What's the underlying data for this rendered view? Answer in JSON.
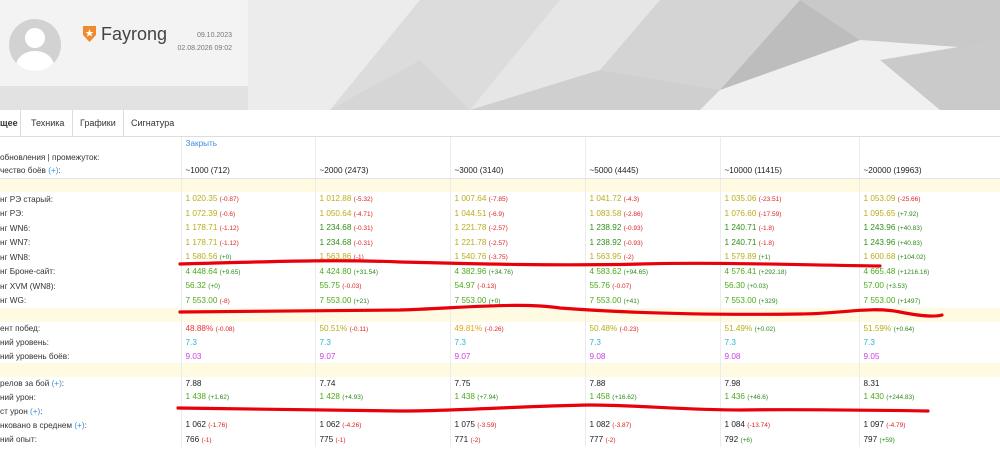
{
  "profile": {
    "name": "Fayrong",
    "date_top": "09.10.2023",
    "date_bottom": "02.08.2026 09:02"
  },
  "tabs": [
    "щее",
    "Техника",
    "Графики",
    "Сигнатура"
  ],
  "table": {
    "close_link": "Закрыть",
    "rows": [
      {
        "type": "header",
        "label": "обновления | промежуток:"
      },
      {
        "type": "head",
        "label": "чество боёв",
        "plus": true,
        "cells": [
          {
            "text": "~1000 (712)"
          },
          {
            "text": "~2000 (2473)"
          },
          {
            "text": "~3000 (3140)"
          },
          {
            "text": "~5000 (4445)"
          },
          {
            "text": "~10000 (11415)"
          },
          {
            "text": "~20000 (19963)"
          }
        ]
      },
      {
        "type": "divider"
      },
      {
        "label": "нг РЭ старый:",
        "cells": [
          {
            "v": "1 020.35",
            "vc": "y",
            "d": "(-0.87)",
            "dc": "dn"
          },
          {
            "v": "1 012.88",
            "vc": "y",
            "d": "(-5.32)",
            "dc": "dn"
          },
          {
            "v": "1 007.64",
            "vc": "y",
            "d": "(-7.85)",
            "dc": "dn"
          },
          {
            "v": "1 041.72",
            "vc": "y",
            "d": "(-4.3)",
            "dc": "dn"
          },
          {
            "v": "1 035.06",
            "vc": "y",
            "d": "(-23.51)",
            "dc": "dn"
          },
          {
            "v": "1 053.09",
            "vc": "y",
            "d": "(-25.66)",
            "dc": "dn"
          }
        ]
      },
      {
        "label": "нг РЭ:",
        "cells": [
          {
            "v": "1 072.39",
            "vc": "y",
            "d": "(-0.6)",
            "dc": "dn"
          },
          {
            "v": "1 050.64",
            "vc": "y",
            "d": "(-4.71)",
            "dc": "dn"
          },
          {
            "v": "1 044.51",
            "vc": "y",
            "d": "(-6.9)",
            "dc": "dn"
          },
          {
            "v": "1 083.58",
            "vc": "y",
            "d": "(-2.86)",
            "dc": "dn"
          },
          {
            "v": "1 076.60",
            "vc": "y",
            "d": "(-17.59)",
            "dc": "dn"
          },
          {
            "v": "1 095.65",
            "vc": "y",
            "d": "(+7.92)",
            "dc": "dp"
          }
        ]
      },
      {
        "label": "нг WN6:",
        "cells": [
          {
            "v": "1 178.71",
            "vc": "y",
            "d": "(-1.12)",
            "dc": "dn"
          },
          {
            "v": "1 234.68",
            "vc": "dg",
            "d": "(-0.31)",
            "dc": "dn"
          },
          {
            "v": "1 221.78",
            "vc": "y",
            "d": "(-2.57)",
            "dc": "dn"
          },
          {
            "v": "1 238.92",
            "vc": "dg",
            "d": "(-0.93)",
            "dc": "dn"
          },
          {
            "v": "1 240.71",
            "vc": "dg",
            "d": "(-1.8)",
            "dc": "dn"
          },
          {
            "v": "1 243.96",
            "vc": "dg",
            "d": "(+40.83)",
            "dc": "dp"
          }
        ]
      },
      {
        "label": "нг WN7:",
        "cells": [
          {
            "v": "1 178.71",
            "vc": "y",
            "d": "(-1.12)",
            "dc": "dn"
          },
          {
            "v": "1 234.68",
            "vc": "dg",
            "d": "(-0.31)",
            "dc": "dn"
          },
          {
            "v": "1 221.78",
            "vc": "y",
            "d": "(-2.57)",
            "dc": "dn"
          },
          {
            "v": "1 238.92",
            "vc": "dg",
            "d": "(-0.93)",
            "dc": "dn"
          },
          {
            "v": "1 240.71",
            "vc": "dg",
            "d": "(-1.8)",
            "dc": "dn"
          },
          {
            "v": "1 243.96",
            "vc": "dg",
            "d": "(+40.83)",
            "dc": "dp"
          }
        ]
      },
      {
        "label": "нг WN8:",
        "cells": [
          {
            "v": "1 580.56",
            "vc": "y",
            "d": "(+0)",
            "dc": "dp"
          },
          {
            "v": "1 563.86",
            "vc": "y",
            "d": "(-1)",
            "dc": "dn"
          },
          {
            "v": "1 540.76",
            "vc": "y",
            "d": "(-3.75)",
            "dc": "dn"
          },
          {
            "v": "1 563.95",
            "vc": "y",
            "d": "(-2)",
            "dc": "dn"
          },
          {
            "v": "1 579.89",
            "vc": "y",
            "d": "(+1)",
            "dc": "dp"
          },
          {
            "v": "1 600.68",
            "vc": "y",
            "d": "(+104.02)",
            "dc": "dp"
          }
        ]
      },
      {
        "label": "нг Броне-сайт:",
        "cells": [
          {
            "v": "4 448.64",
            "vc": "g",
            "d": "(+9.65)",
            "dc": "dp"
          },
          {
            "v": "4 424.80",
            "vc": "g",
            "d": "(+31.54)",
            "dc": "dp"
          },
          {
            "v": "4 382.96",
            "vc": "g",
            "d": "(+34.76)",
            "dc": "dp"
          },
          {
            "v": "4 583.62",
            "vc": "g",
            "d": "(+94.65)",
            "dc": "dp"
          },
          {
            "v": "4 576.41",
            "vc": "g",
            "d": "(+292.18)",
            "dc": "dp"
          },
          {
            "v": "4 665.48",
            "vc": "g",
            "d": "(+1216.16)",
            "dc": "dp"
          }
        ]
      },
      {
        "label": "нг XVM (WN8):",
        "cells": [
          {
            "v": "56.32",
            "vc": "g",
            "d": "(+0)",
            "dc": "dp"
          },
          {
            "v": "55.75",
            "vc": "g",
            "d": "(-0.03)",
            "dc": "dn"
          },
          {
            "v": "54.97",
            "vc": "g",
            "d": "(-0.13)",
            "dc": "dn"
          },
          {
            "v": "55.76",
            "vc": "g",
            "d": "(-0.07)",
            "dc": "dn"
          },
          {
            "v": "56.30",
            "vc": "g",
            "d": "(+0.03)",
            "dc": "dp"
          },
          {
            "v": "57.00",
            "vc": "g",
            "d": "(+3.53)",
            "dc": "dp"
          }
        ]
      },
      {
        "label": "нг WG:",
        "cells": [
          {
            "v": "7 553.00",
            "vc": "g",
            "d": "(-8)",
            "dc": "dn"
          },
          {
            "v": "7 553.00",
            "vc": "g",
            "d": "(+21)",
            "dc": "dp"
          },
          {
            "v": "7 553.00",
            "vc": "g",
            "d": "(+0)",
            "dc": "dp"
          },
          {
            "v": "7 553.00",
            "vc": "g",
            "d": "(+41)",
            "dc": "dp"
          },
          {
            "v": "7 553.00",
            "vc": "g",
            "d": "(+329)",
            "dc": "dp"
          },
          {
            "v": "7 553.00",
            "vc": "g",
            "d": "(+1497)",
            "dc": "dp"
          }
        ]
      },
      {
        "type": "divider"
      },
      {
        "label": "ент побед:",
        "cells": [
          {
            "v": "48.88%",
            "vc": "r",
            "d": "(-0.08)",
            "dc": "dn"
          },
          {
            "v": "50.51%",
            "vc": "y",
            "d": "(-0.11)",
            "dc": "dn"
          },
          {
            "v": "49.81%",
            "vc": "o",
            "d": "(-0.26)",
            "dc": "dn"
          },
          {
            "v": "50.48%",
            "vc": "y",
            "d": "(-0.23)",
            "dc": "dn"
          },
          {
            "v": "51.49%",
            "vc": "y",
            "d": "(+0.02)",
            "dc": "dp"
          },
          {
            "v": "51.59%",
            "vc": "y",
            "d": "(+0.64)",
            "dc": "dp"
          }
        ]
      },
      {
        "label": "ний уровень:",
        "cells": [
          {
            "v": "7.3",
            "vc": "c"
          },
          {
            "v": "7.3",
            "vc": "c"
          },
          {
            "v": "7.3",
            "vc": "c"
          },
          {
            "v": "7.3",
            "vc": "c"
          },
          {
            "v": "7.3",
            "vc": "c"
          },
          {
            "v": "7.3",
            "vc": "c"
          }
        ]
      },
      {
        "label": "ний уровень боёв:",
        "cells": [
          {
            "v": "9.03",
            "vc": "m"
          },
          {
            "v": "9.07",
            "vc": "m"
          },
          {
            "v": "9.07",
            "vc": "m"
          },
          {
            "v": "9.08",
            "vc": "m"
          },
          {
            "v": "9.08",
            "vc": "m"
          },
          {
            "v": "9.05",
            "vc": "m"
          }
        ]
      },
      {
        "type": "divider"
      },
      {
        "label": "релов за бой",
        "plus": true,
        "cells": [
          {
            "v": "7.88",
            "vc": "k"
          },
          {
            "v": "7.74",
            "vc": "k"
          },
          {
            "v": "7.75",
            "vc": "k"
          },
          {
            "v": "7.88",
            "vc": "k"
          },
          {
            "v": "7.98",
            "vc": "k"
          },
          {
            "v": "8.31",
            "vc": "k"
          }
        ]
      },
      {
        "label": "ний урон:",
        "cells": [
          {
            "v": "1 438",
            "vc": "g",
            "d": "(+1.62)",
            "dc": "dp"
          },
          {
            "v": "1 428",
            "vc": "g",
            "d": "(+4.93)",
            "dc": "dp"
          },
          {
            "v": "1 438",
            "vc": "g",
            "d": "(+7.94)",
            "dc": "dp"
          },
          {
            "v": "1 458",
            "vc": "g",
            "d": "(+16.62)",
            "dc": "dp"
          },
          {
            "v": "1 436",
            "vc": "g",
            "d": "(+46.6)",
            "dc": "dp"
          },
          {
            "v": "1 430",
            "vc": "g",
            "d": "(+244.83)",
            "dc": "dp"
          }
        ]
      },
      {
        "label": "ст урон",
        "plus": true,
        "cells": []
      },
      {
        "label": "нковано в среднем",
        "plus": true,
        "cells": [
          {
            "v": "1 062",
            "vc": "k",
            "d": "(-1.76)",
            "dc": "dn"
          },
          {
            "v": "1 062",
            "vc": "k",
            "d": "(-4.26)",
            "dc": "dn"
          },
          {
            "v": "1 075",
            "vc": "k",
            "d": "(-3.59)",
            "dc": "dn"
          },
          {
            "v": "1 082",
            "vc": "k",
            "d": "(-3.87)",
            "dc": "dn"
          },
          {
            "v": "1 084",
            "vc": "k",
            "d": "(-13.74)",
            "dc": "dn"
          },
          {
            "v": "1 097",
            "vc": "k",
            "d": "(-4.79)",
            "dc": "dn"
          }
        ]
      },
      {
        "label": "ний опыт:",
        "cells": [
          {
            "v": "766",
            "vc": "k",
            "d": "(-1)",
            "dc": "dn"
          },
          {
            "v": "775",
            "vc": "k",
            "d": "(-1)",
            "dc": "dn"
          },
          {
            "v": "771",
            "vc": "k",
            "d": "(-2)",
            "dc": "dn"
          },
          {
            "v": "777",
            "vc": "k",
            "d": "(-2)",
            "dc": "dn"
          },
          {
            "v": "792",
            "vc": "k",
            "d": "(+6)",
            "dc": "dp"
          },
          {
            "v": "797",
            "vc": "k",
            "d": "(+59)",
            "dc": "dp"
          }
        ]
      }
    ]
  },
  "colors": {
    "link_blue": "#3c8dde",
    "value_green": "#4caa1c",
    "value_yellow": "#b9ae18",
    "value_red": "#e33",
    "value_cyan": "#2fb4d6",
    "value_magenta": "#cc3fe0",
    "divider_yellow": "#fffbe3",
    "annotation_red": "#e8000a"
  }
}
